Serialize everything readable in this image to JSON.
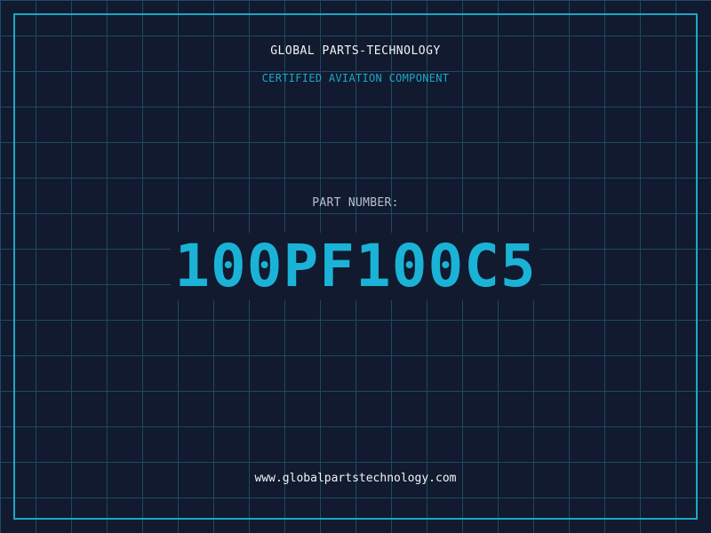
{
  "header": {
    "company": "GLOBAL PARTS-TECHNOLOGY",
    "subtitle": "CERTIFIED AVIATION COMPONENT"
  },
  "part": {
    "label": "PART NUMBER:",
    "number": "100PF100C5"
  },
  "footer": {
    "url": "www.globalpartstechnology.com"
  },
  "colors": {
    "background": "#111a2e",
    "grid": "#1d4a63",
    "accent": "#1ba7c9",
    "part_number": "#1ab3d7",
    "text": "#f2f4f8",
    "label": "#b9c1cf"
  }
}
